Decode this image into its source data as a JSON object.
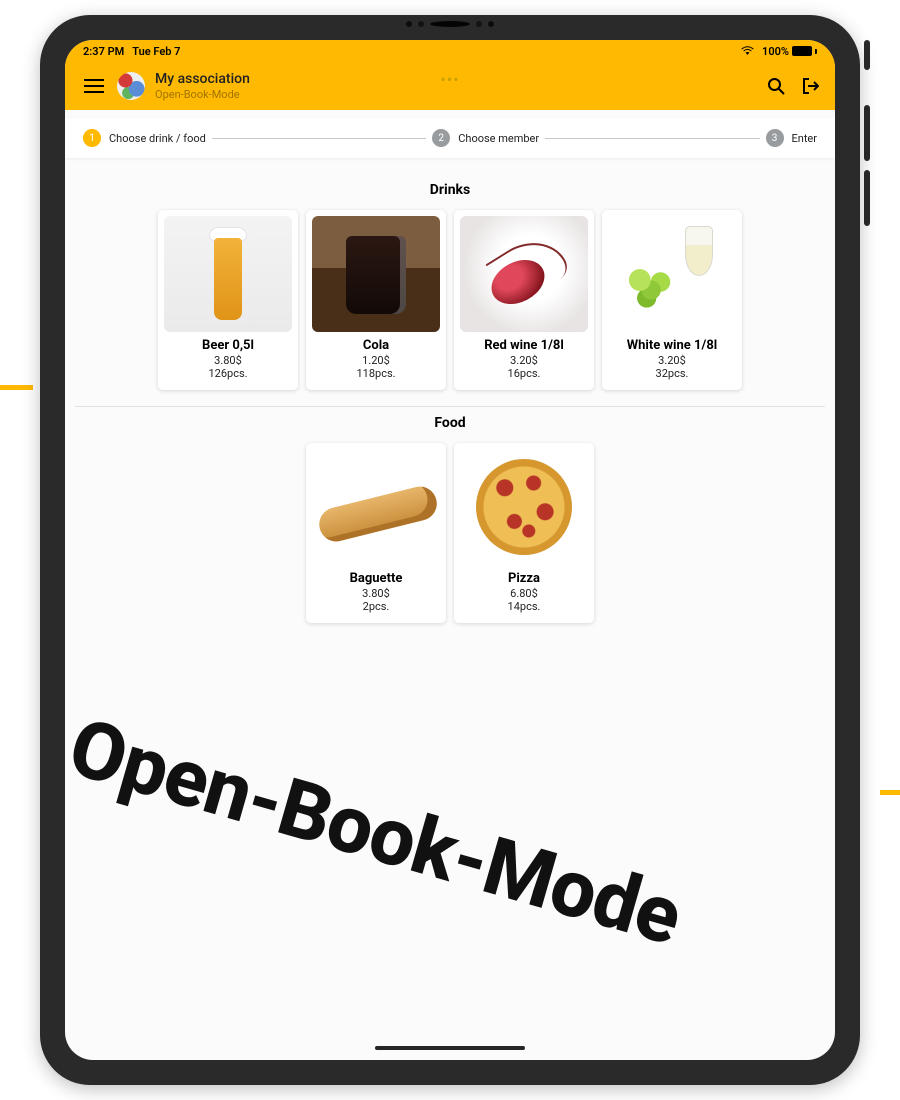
{
  "status": {
    "time": "2:37 PM",
    "date": "Tue Feb 7",
    "battery": "100%"
  },
  "header": {
    "title": "My association",
    "subtitle": "Open-Book-Mode"
  },
  "stepper": {
    "steps": [
      {
        "label": "Choose drink / food"
      },
      {
        "label": "Choose member"
      },
      {
        "label": "Enter"
      }
    ]
  },
  "sections": {
    "drinks_title": "Drinks",
    "food_title": "Food",
    "drinks": [
      {
        "name": "Beer 0,5l",
        "price": "3.80$",
        "qty": "126pcs."
      },
      {
        "name": "Cola",
        "price": "1.20$",
        "qty": "118pcs."
      },
      {
        "name": "Red wine 1/8l",
        "price": "3.20$",
        "qty": "16pcs."
      },
      {
        "name": "White wine 1/8l",
        "price": "3.20$",
        "qty": "32pcs."
      }
    ],
    "food": [
      {
        "name": "Baguette",
        "price": "3.80$",
        "qty": "2pcs."
      },
      {
        "name": "Pizza",
        "price": "6.80$",
        "qty": "14pcs."
      }
    ]
  },
  "overlay": "Open-Book-Mode",
  "colors": {
    "accent": "#FFB900",
    "grey": "#989C9F"
  }
}
